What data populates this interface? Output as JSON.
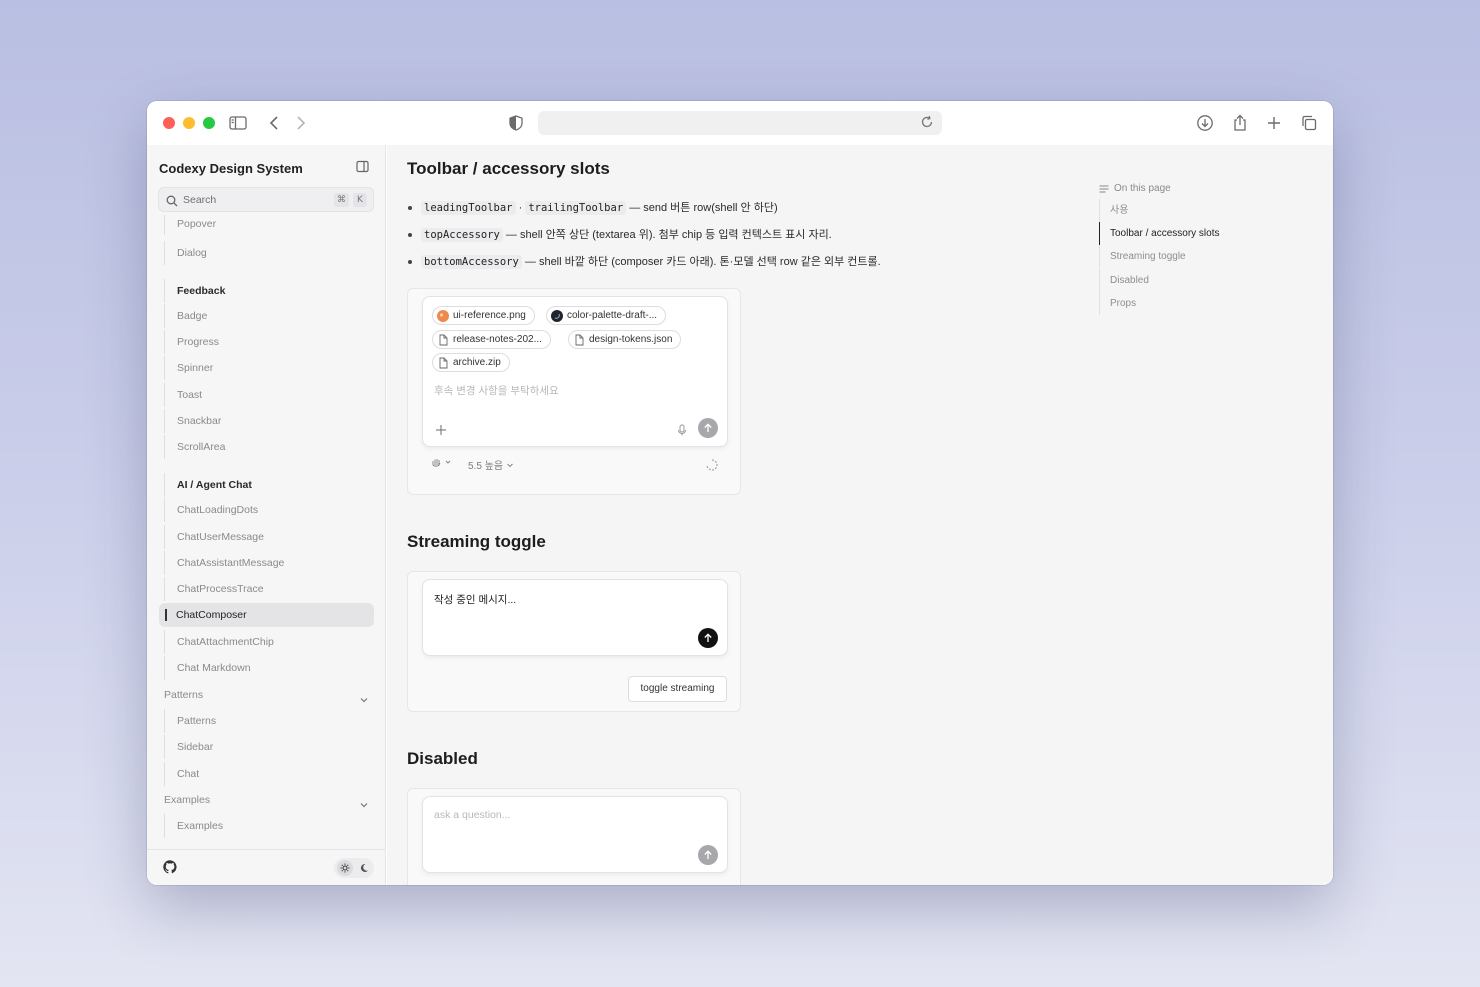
{
  "colors": {
    "accent": "#111111",
    "traffic_red": "#fe5f57",
    "traffic_yellow": "#febc2e",
    "traffic_green": "#28c840"
  },
  "browser": {
    "address": ""
  },
  "sidebar": {
    "title": "Codexy Design System",
    "search": {
      "placeholder": "Search",
      "shortcut_mod": "⌘",
      "shortcut_key": "K"
    },
    "items": [
      {
        "label": "Popover",
        "kind": "item"
      },
      {
        "label": "Dialog",
        "kind": "item"
      },
      {
        "label": "Feedback",
        "kind": "heading"
      },
      {
        "label": "Badge",
        "kind": "item"
      },
      {
        "label": "Progress",
        "kind": "item"
      },
      {
        "label": "Spinner",
        "kind": "item"
      },
      {
        "label": "Toast",
        "kind": "item"
      },
      {
        "label": "Snackbar",
        "kind": "item"
      },
      {
        "label": "ScrollArea",
        "kind": "item"
      },
      {
        "label": "AI / Agent Chat",
        "kind": "heading"
      },
      {
        "label": "ChatLoadingDots",
        "kind": "item"
      },
      {
        "label": "ChatUserMessage",
        "kind": "item"
      },
      {
        "label": "ChatAssistantMessage",
        "kind": "item"
      },
      {
        "label": "ChatProcessTrace",
        "kind": "item"
      },
      {
        "label": "ChatComposer",
        "kind": "active"
      },
      {
        "label": "ChatAttachmentChip",
        "kind": "item"
      },
      {
        "label": "Chat Markdown",
        "kind": "item"
      },
      {
        "label": "Patterns",
        "kind": "group"
      },
      {
        "label": "Patterns",
        "kind": "item"
      },
      {
        "label": "Sidebar",
        "kind": "item"
      },
      {
        "label": "Chat",
        "kind": "item"
      },
      {
        "label": "Examples",
        "kind": "group"
      },
      {
        "label": "Examples",
        "kind": "item"
      }
    ]
  },
  "main": {
    "section1": {
      "title": "Toolbar / accessory slots",
      "bullets": [
        {
          "code1": "leadingToolbar",
          "sep": "·",
          "code2": "trailingToolbar",
          "text": "— send 버튼 row(shell 안 하단)"
        },
        {
          "code1": "topAccessory",
          "text": "— shell 안쪽 상단 (textarea 위). 첨부 chip 등 입력 컨텍스트 표시 자리."
        },
        {
          "code1": "bottomAccessory",
          "text": "— shell 바깥 하단 (composer 카드 아래). 톤·모델 선택 row 같은 외부 컨트롤."
        }
      ],
      "chips": [
        "ui-reference.png",
        "color-palette-draft-...",
        "release-notes-202...",
        "design-tokens.json",
        "archive.zip"
      ],
      "placeholder": "후속 변경 사항을 부탁하세요",
      "model_label": "5.5 높음"
    },
    "section2": {
      "title": "Streaming toggle",
      "message": "작성 중인 메시지...",
      "toggle_label": "toggle streaming"
    },
    "section3": {
      "title": "Disabled",
      "placeholder": "ask a question..."
    }
  },
  "toc": {
    "heading": "On this page",
    "items": [
      "사용",
      "Toolbar / accessory slots",
      "Streaming toggle",
      "Disabled",
      "Props"
    ],
    "active_index": 1
  }
}
